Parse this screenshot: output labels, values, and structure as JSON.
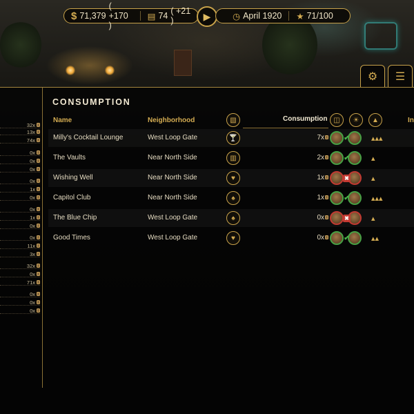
{
  "topbar": {
    "money_icon": "dollar-icon",
    "money": "71,379",
    "money_delta": "( +170 )",
    "workers_icon": "building-icon",
    "workers": "74",
    "workers_delta": "( +21 )",
    "play_icon": "play-icon",
    "date_icon": "clock-icon",
    "date": "April 1920",
    "rep_icon": "star-icon",
    "reputation": "71/100"
  },
  "corner_button_icon": "settings-gear-icon",
  "panel": {
    "title": "CONSUMPTION",
    "columns": {
      "name": "Name",
      "neighborhood": "Neighborhood",
      "consumption": "Consumption",
      "cutoff": "In"
    },
    "header_icons": [
      "venue-type-icon",
      "barrel-icon",
      "quality-icon",
      "level-icon"
    ],
    "rows": [
      {
        "name": "Milly's Cocktail Lounge",
        "neighborhood": "West Loop Gate",
        "consumption": "7x",
        "status": [
          "ok",
          "ok"
        ],
        "icon": "cocktail-icon",
        "level": 3
      },
      {
        "name": "The Vaults",
        "neighborhood": "Near North Side",
        "consumption": "2x",
        "status": [
          "ok",
          "ok"
        ],
        "icon": "bank-icon",
        "level": 1
      },
      {
        "name": "Wishing Well",
        "neighborhood": "Near North Side",
        "consumption": "1x",
        "status": [
          "bad",
          "bad"
        ],
        "icon": "heart-icon",
        "level": 1
      },
      {
        "name": "Capitol Club",
        "neighborhood": "Near North Side",
        "consumption": "1x",
        "status": [
          "ok",
          "ok"
        ],
        "icon": "cards-icon",
        "level": 3
      },
      {
        "name": "The Blue Chip",
        "neighborhood": "West Loop Gate",
        "consumption": "0x",
        "status": [
          "bad",
          "bad"
        ],
        "icon": "cards-icon",
        "level": 1
      },
      {
        "name": "Good Times",
        "neighborhood": "West Loop Gate",
        "consumption": "0x",
        "status": [
          "ok",
          "ok"
        ],
        "icon": "heart-icon",
        "level": 2
      }
    ]
  },
  "left_column": {
    "values": [
      "32x",
      "13x",
      "74x",
      "0x",
      "0x",
      "0x",
      "0x",
      "1x",
      "0x",
      "0x",
      "1x",
      "0x",
      "0x",
      "11x",
      "3x",
      "32x",
      "0x",
      "71x",
      "0x",
      "0x",
      "0x"
    ]
  }
}
